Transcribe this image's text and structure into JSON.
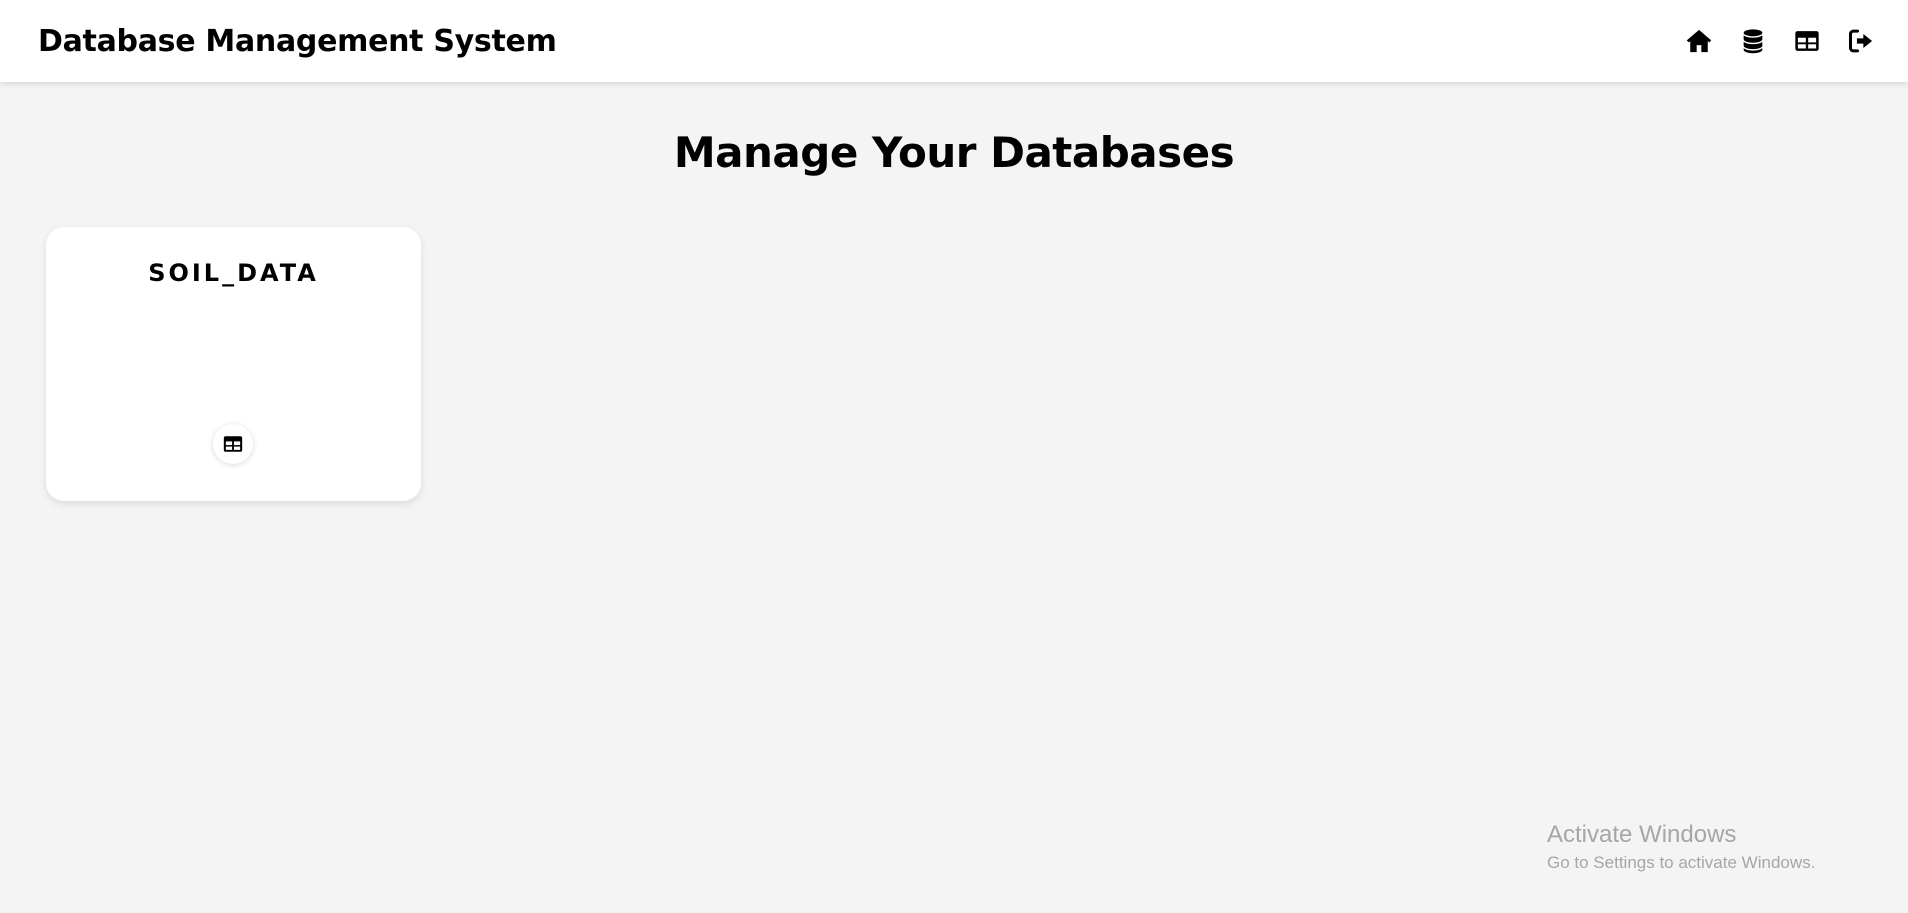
{
  "header": {
    "title": "Database Management System",
    "nav": [
      {
        "icon": "home-icon"
      },
      {
        "icon": "database-icon"
      },
      {
        "icon": "table-icon"
      },
      {
        "icon": "sign-out-icon"
      }
    ]
  },
  "main": {
    "heading": "Manage Your Databases",
    "databases": [
      {
        "name": "SOIL_DATA",
        "action_icon": "table-icon"
      }
    ]
  },
  "watermark": {
    "title": "Activate Windows",
    "subtitle": "Go to Settings to activate Windows."
  }
}
